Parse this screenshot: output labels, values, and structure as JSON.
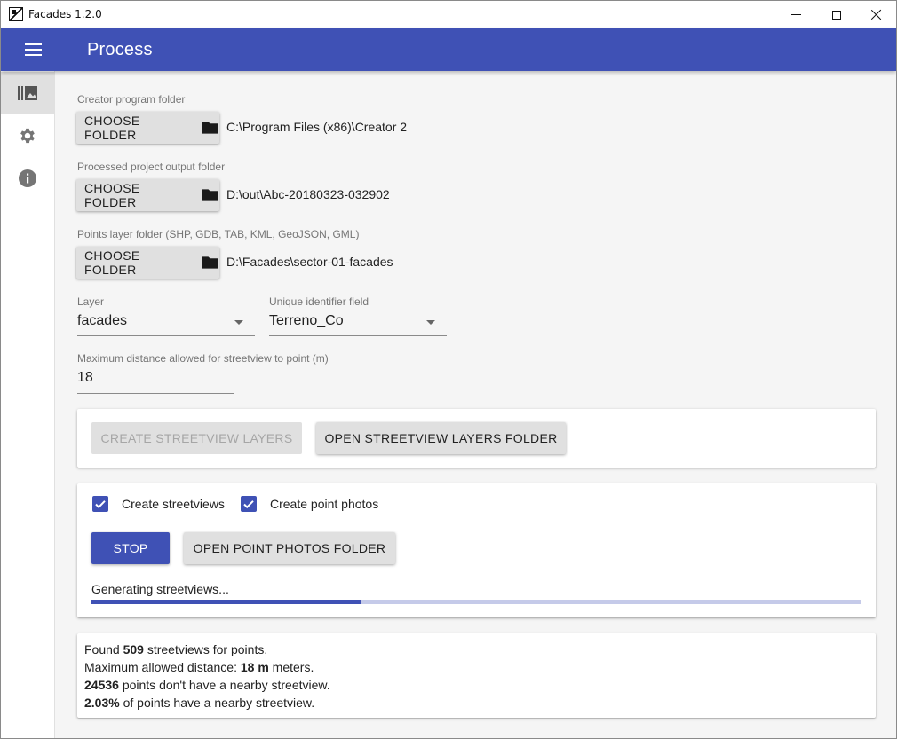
{
  "window": {
    "title": "Facades 1.2.0",
    "buttons": [
      "minimize",
      "maximize",
      "close"
    ]
  },
  "appbar": {
    "title": "Process",
    "color": "#3f51b5"
  },
  "sidebar": {
    "items": [
      {
        "icon": "photo-library-icon",
        "active": true
      },
      {
        "icon": "settings-icon",
        "active": false
      },
      {
        "icon": "info-icon",
        "active": false
      }
    ]
  },
  "folders": {
    "button_label": "CHOOSE FOLDER",
    "creator": {
      "label": "Creator program folder",
      "path": "C:\\Program Files (x86)\\Creator 2"
    },
    "output": {
      "label": "Processed project output folder",
      "path": "D:\\out\\Abc-20180323-032902"
    },
    "points": {
      "label": "Points layer folder (SHP, GDB, TAB, KML, GeoJSON, GML)",
      "path": "D:\\Facades\\sector-01-facades"
    }
  },
  "layer": {
    "label": "Layer",
    "value": "facades"
  },
  "uid_field": {
    "label": "Unique identifier field",
    "value": "Terreno_Co"
  },
  "max_distance": {
    "label": "Maximum distance allowed for streetview to point (m)",
    "value": "18"
  },
  "streetview_layers": {
    "create_label": "CREATE STREETVIEW LAYERS",
    "open_label": "OPEN STREETVIEW LAYERS FOLDER"
  },
  "photos": {
    "create_streetviews_label": "Create streetviews",
    "create_streetviews_checked": true,
    "create_point_photos_label": "Create point photos",
    "create_point_photos_checked": true,
    "stop_label": "STOP",
    "open_folder_label": "OPEN POINT PHOTOS FOLDER",
    "status": "Generating streetviews...",
    "progress": 0.35
  },
  "report": {
    "line1_prefix": "Found ",
    "line1_value": "509",
    "line1_suffix": " streetviews for points.",
    "line2_prefix": "Maximum allowed distance: ",
    "line2_value": "18 m",
    "line2_suffix": " meters.",
    "line3_value": "24536",
    "line3_suffix": " points don't have a nearby streetview.",
    "line4_value": "2.03%",
    "line4_suffix": " of points have a nearby streetview."
  }
}
